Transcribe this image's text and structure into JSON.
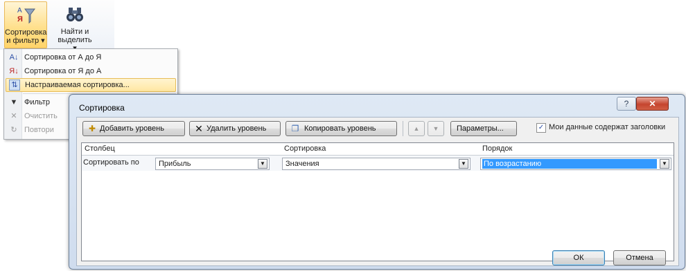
{
  "ribbon": {
    "sort_filter_label_1": "Сортировка",
    "sort_filter_label_2": "и фильтр ▾",
    "find_select_label_1": "Найти и",
    "find_select_label_2": "выделить ▾"
  },
  "menu": {
    "items": [
      {
        "label": "Сортировка от А до Я",
        "icon": "sort-az-icon"
      },
      {
        "label": "Сортировка от Я до А",
        "icon": "sort-za-icon"
      },
      {
        "label": "Настраиваемая сортировка...",
        "icon": "custom-sort-icon"
      },
      {
        "label": "Фильтр",
        "icon": "filter-icon"
      },
      {
        "label": "Очистить",
        "icon": "clear-filter-icon"
      },
      {
        "label": "Повтори",
        "icon": "reapply-icon"
      }
    ]
  },
  "dialog": {
    "title": "Сортировка",
    "help_label": "?",
    "close_label": "✕",
    "toolbar": {
      "add_level": "Добавить уровень",
      "delete_level": "Удалить уровень",
      "copy_level": "Копировать уровень",
      "options": "Параметры...",
      "headers_checkbox": "Мои данные содержат заголовки",
      "headers_checked": true
    },
    "columns": {
      "column": "Столбец",
      "sort_on": "Сортировка",
      "order": "Порядок"
    },
    "row": {
      "label": "Сортировать по",
      "column_value": "Прибыль",
      "sort_on_value": "Значения",
      "order_value": "По возрастанию"
    },
    "ok": "ОК",
    "cancel": "Отмена"
  },
  "colors": {
    "accent": "#3399ff",
    "highlight": "#ffe7a2",
    "close": "#c5452f"
  }
}
